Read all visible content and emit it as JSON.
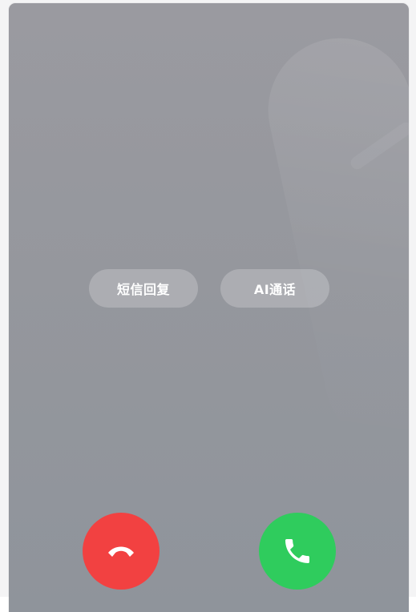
{
  "quick_actions": {
    "sms_reply_label": "短信回复",
    "ai_call_label": "AI通话"
  },
  "call_controls": {
    "decline_icon": "phone-hangup-icon",
    "accept_icon": "phone-icon",
    "decline_color": "#f24141",
    "accept_color": "#2fcc5d"
  }
}
